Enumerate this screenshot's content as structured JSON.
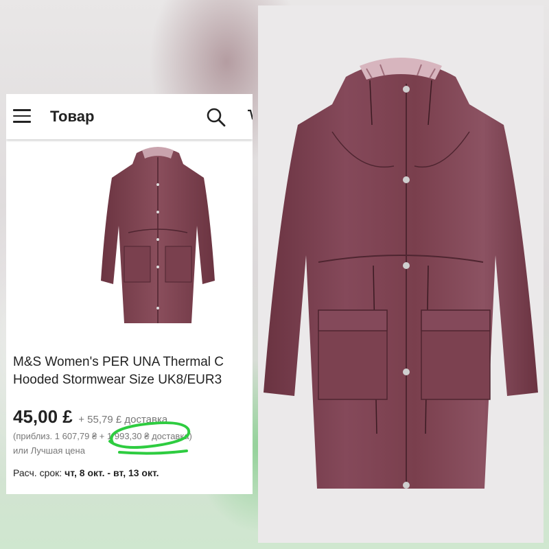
{
  "app": {
    "title": "Товар"
  },
  "icons": {
    "menu": "hamburger-menu-icon",
    "search": "search-icon",
    "cart": "cart-icon"
  },
  "product": {
    "title_line1": "M&S Women's PER UNA Thermal C",
    "title_line2": "Hooded Stormwear Size UK8/EUR3",
    "price": "45,00 £",
    "shipping": "+ 55,79 £ доставка",
    "approx": "(приблиз. 1 607,79 ₴ + 1 993,30 ₴ доставка)",
    "best_offer": "или Лучшая цена",
    "delivery_label": "Расч. срок:",
    "delivery_dates": "чт, 8 окт. - вт, 13 окт."
  },
  "colors": {
    "coat": "#7a3f4d",
    "highlight": "#2ecc40"
  }
}
